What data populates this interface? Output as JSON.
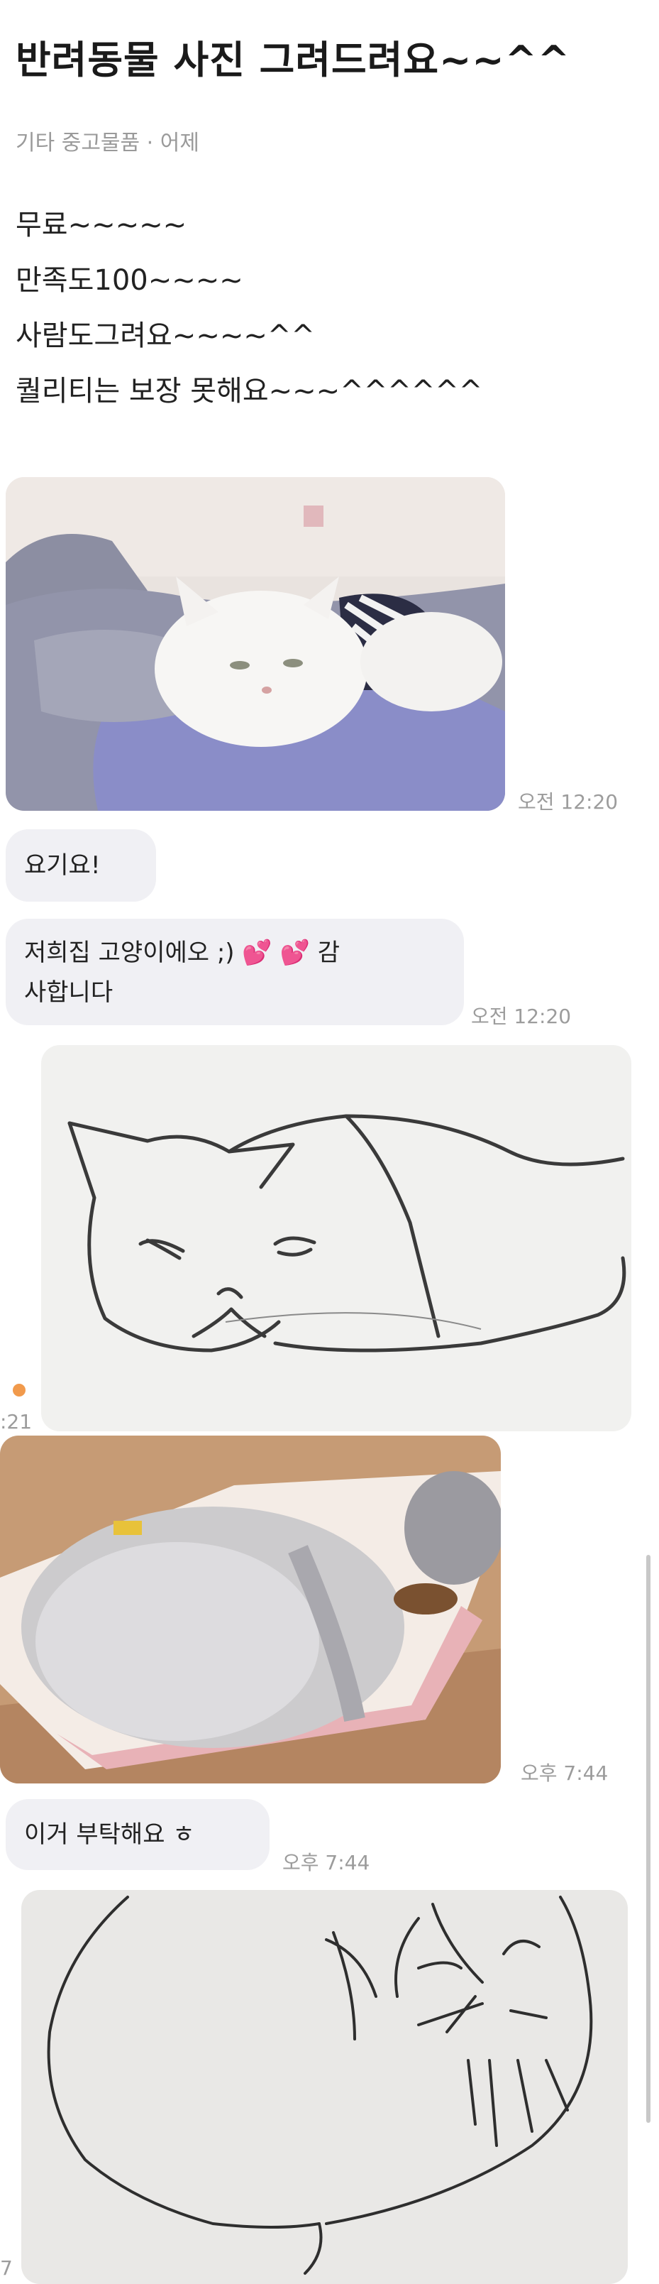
{
  "post": {
    "title": "반려동물 사진 그려드려요~~^^",
    "meta": "기타 중고물품 · 어제",
    "body_lines": [
      "무료~~~~~",
      "만족도100~~~~",
      "사람도그려요~~~~^^",
      "퀄리티는 보장 못해요~~~^^^^^^"
    ]
  },
  "chat": {
    "message1_time": "오전 12:20",
    "bubble1": "요기요!",
    "bubble2_line1": "저희집 고양이에오 ;)",
    "bubble2_emoji": "💕 💕",
    "bubble2_line1_end": "감",
    "bubble2_line2": "사합니다",
    "bubble2_time": "오전 12:20",
    "edge_time_fragment": ":21",
    "photo2_time": "오후 7:44",
    "bubble3": "이거 부탁해요 ㅎ",
    "bubble3_time": "오후 7:44",
    "bottom_edge_fragment": "7"
  }
}
